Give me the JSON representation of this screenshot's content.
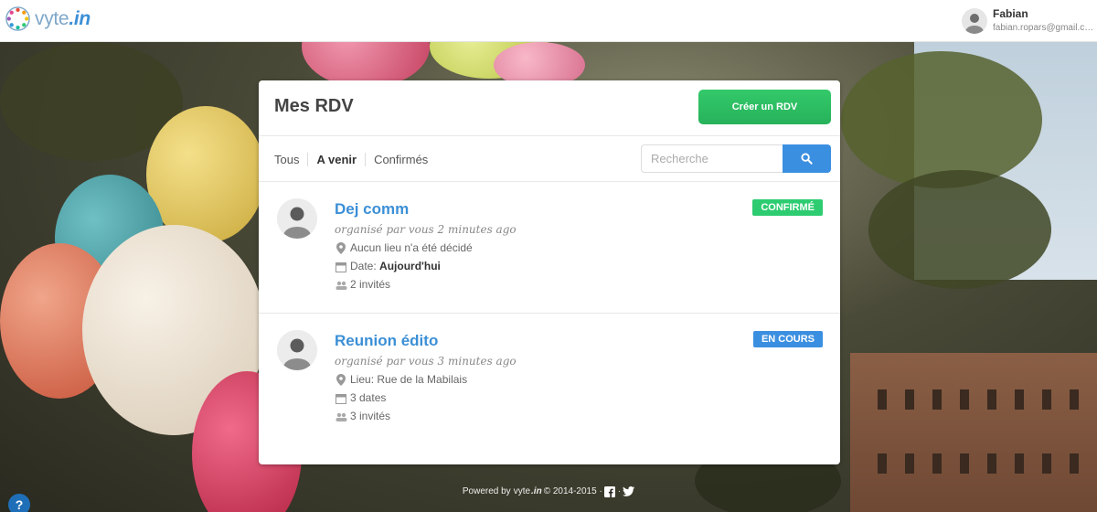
{
  "header": {
    "logo_text": "vyte",
    "logo_suffix": ".in",
    "user": {
      "name": "Fabian",
      "email": "fabian.ropars@gmail.com"
    }
  },
  "panel": {
    "title": "Mes RDV",
    "create_button": "Créer un RDV",
    "filters": [
      {
        "label": "Tous",
        "active": false
      },
      {
        "label": "A venir",
        "active": true
      },
      {
        "label": "Confirmés",
        "active": false
      }
    ],
    "search": {
      "placeholder": "Recherche",
      "icon": "search-icon"
    },
    "events": [
      {
        "title": "Dej comm",
        "organizer": "organisé par vous 2 minutes ago",
        "badge": "CONFIRMÉ",
        "badge_color": "#2ecc71",
        "location": "Aucun lieu n'a été décidé",
        "date_label": "Date:",
        "date_value": "Aujourd'hui",
        "invites": "2 invités"
      },
      {
        "title": "Reunion édito",
        "organizer": "organisé par vous 3 minutes ago",
        "badge": "EN COURS",
        "badge_color": "#3b8fe0",
        "location": "Lieu: Rue de la Mabilais",
        "dates": "3 dates",
        "invites": "3 invités"
      }
    ]
  },
  "footer": {
    "powered_by": "Powered by",
    "brand": "vyte",
    "brand_suffix": ".in",
    "copyright": "© 2014-2015 ·",
    "separator": "·"
  },
  "help_label": "?",
  "colors": {
    "accent_blue": "#3b8fd6",
    "green": "#2ecc71",
    "button_blue": "#3b8fe0"
  }
}
